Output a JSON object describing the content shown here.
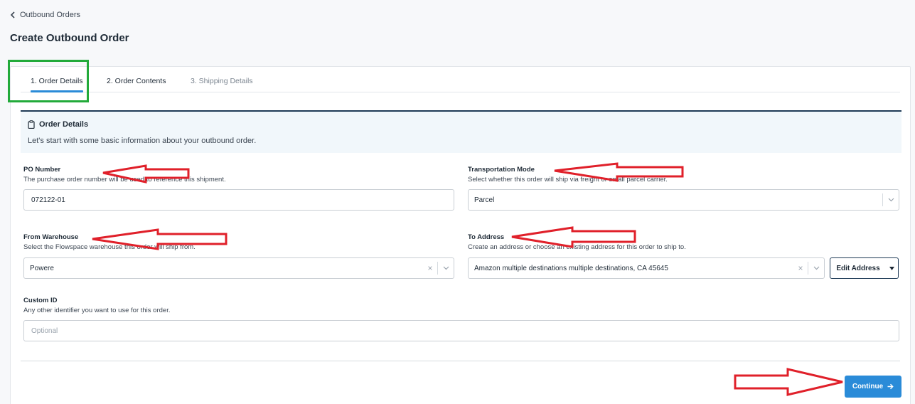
{
  "breadcrumb": {
    "label": "Outbound Orders",
    "icon": "chevron-left-icon"
  },
  "page_title": "Create Outbound Order",
  "tabs": [
    {
      "label": "1. Order Details",
      "active": true
    },
    {
      "label": "2. Order Contents",
      "active": false
    },
    {
      "label": "3. Shipping Details",
      "active": false
    }
  ],
  "info": {
    "icon": "clipboard-icon",
    "title": "Order Details",
    "description": "Let's start with some basic information about your outbound order."
  },
  "fields": {
    "po_number": {
      "label": "PO Number",
      "help": "The purchase order number will be used to reference this shipment.",
      "value": "072122-01"
    },
    "transportation_mode": {
      "label": "Transportation Mode",
      "help": "Select whether this order will ship via freight or small parcel carrier.",
      "value": "Parcel"
    },
    "from_warehouse": {
      "label": "From Warehouse",
      "help": "Select the Flowspace warehouse this order will ship from.",
      "value": "Powere"
    },
    "to_address": {
      "label": "To Address",
      "help": "Create an address or choose an existing address for this order to ship to.",
      "value": "Amazon multiple destinations multiple destinations, CA 45645",
      "edit_button": "Edit Address"
    },
    "custom_id": {
      "label": "Custom ID",
      "help": "Any other identifier you want to use for this order.",
      "placeholder": "Optional"
    }
  },
  "actions": {
    "continue_label": "Continue"
  },
  "colors": {
    "primary": "#2a8bd8",
    "navy": "#1e3a56",
    "annotation_green": "#22aa3a",
    "annotation_red": "#e0202a"
  }
}
